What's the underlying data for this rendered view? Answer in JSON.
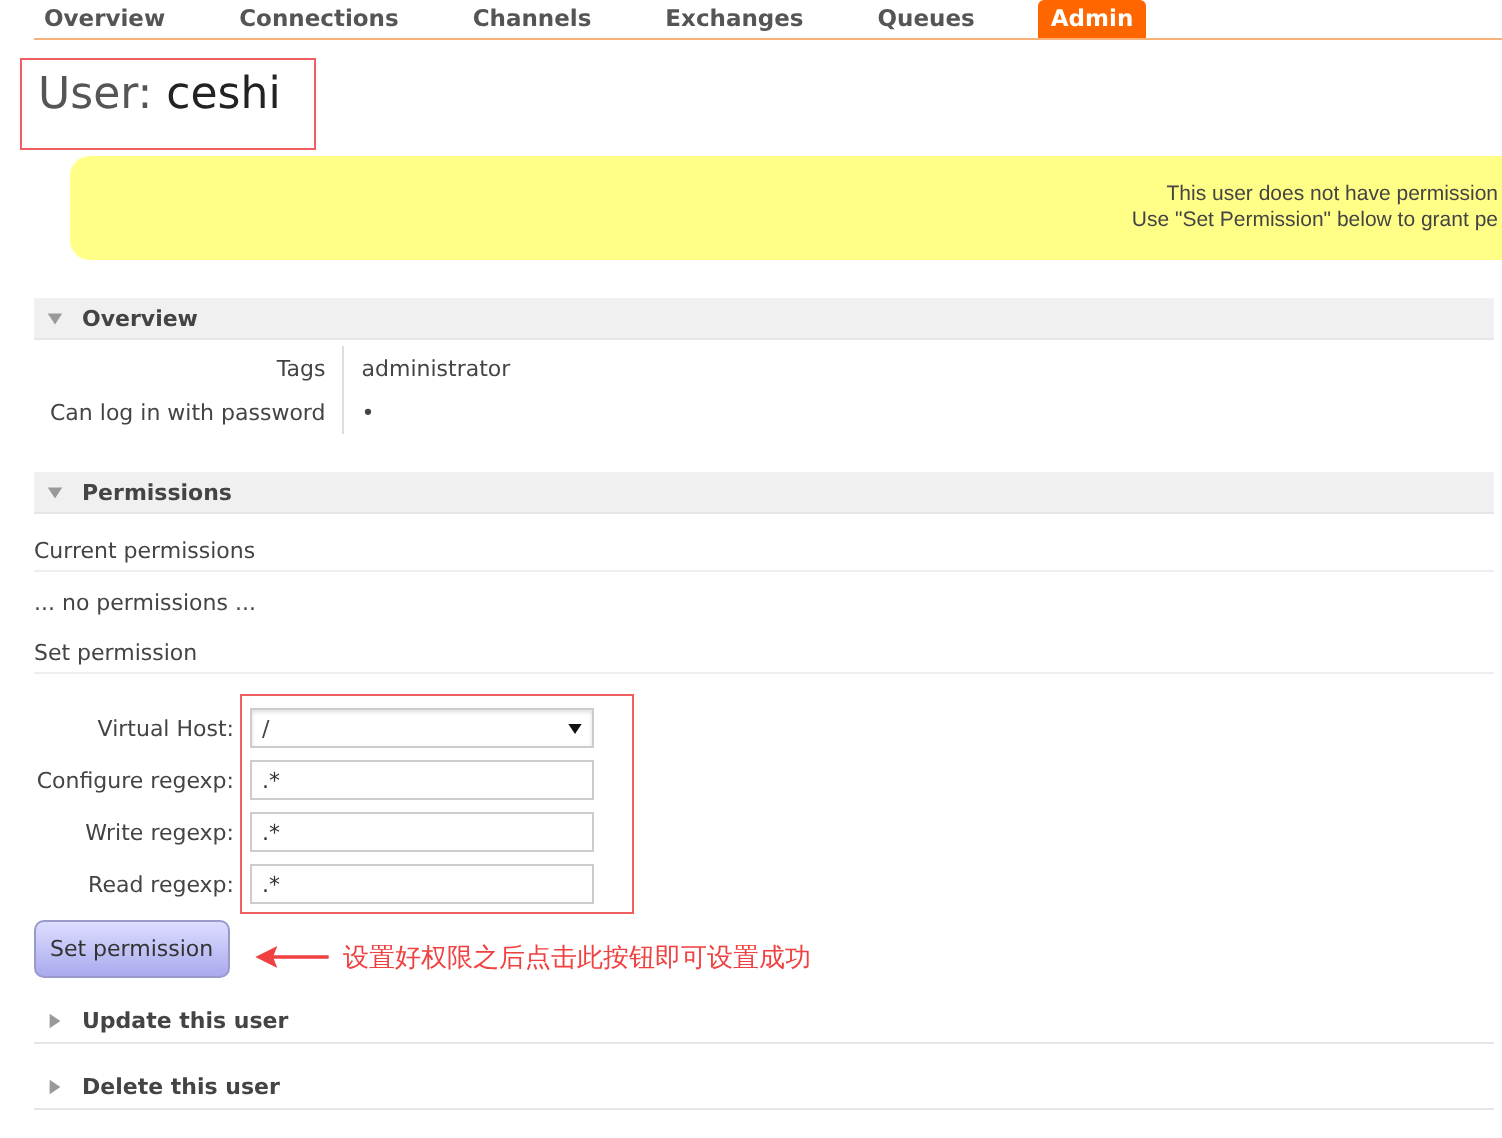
{
  "tabs": [
    {
      "label": "Overview",
      "selected": false
    },
    {
      "label": "Connections",
      "selected": false
    },
    {
      "label": "Channels",
      "selected": false
    },
    {
      "label": "Exchanges",
      "selected": false
    },
    {
      "label": "Queues",
      "selected": false
    },
    {
      "label": "Admin",
      "selected": true
    }
  ],
  "title": {
    "prefix": "User:",
    "name": "ceshi"
  },
  "notice": [
    "This user does not have permission",
    "Use \"Set Permission\" below to grant pe"
  ],
  "overview": {
    "heading": "Overview",
    "expanded": true,
    "rows": [
      {
        "label": "Tags",
        "value": "administrator"
      },
      {
        "label": "Can log in with password",
        "value": "•"
      }
    ]
  },
  "permissions": {
    "heading": "Permissions",
    "expanded": true,
    "current_heading": "Current permissions",
    "current_empty": "... no permissions ...",
    "set_heading": "Set permission",
    "fields": [
      {
        "kind": "select",
        "label": "Virtual Host:",
        "value": "/"
      },
      {
        "kind": "text",
        "label": "Configure regexp:",
        "value": ".*"
      },
      {
        "kind": "text",
        "label": "Write regexp:",
        "value": ".*"
      },
      {
        "kind": "text",
        "label": "Read regexp:",
        "value": ".*"
      }
    ],
    "button": "Set permission",
    "annotation": "设置好权限之后点击此按钮即可设置成功"
  },
  "sections": [
    {
      "heading": "Update this user",
      "expanded": false
    },
    {
      "heading": "Delete this user",
      "expanded": false
    }
  ]
}
